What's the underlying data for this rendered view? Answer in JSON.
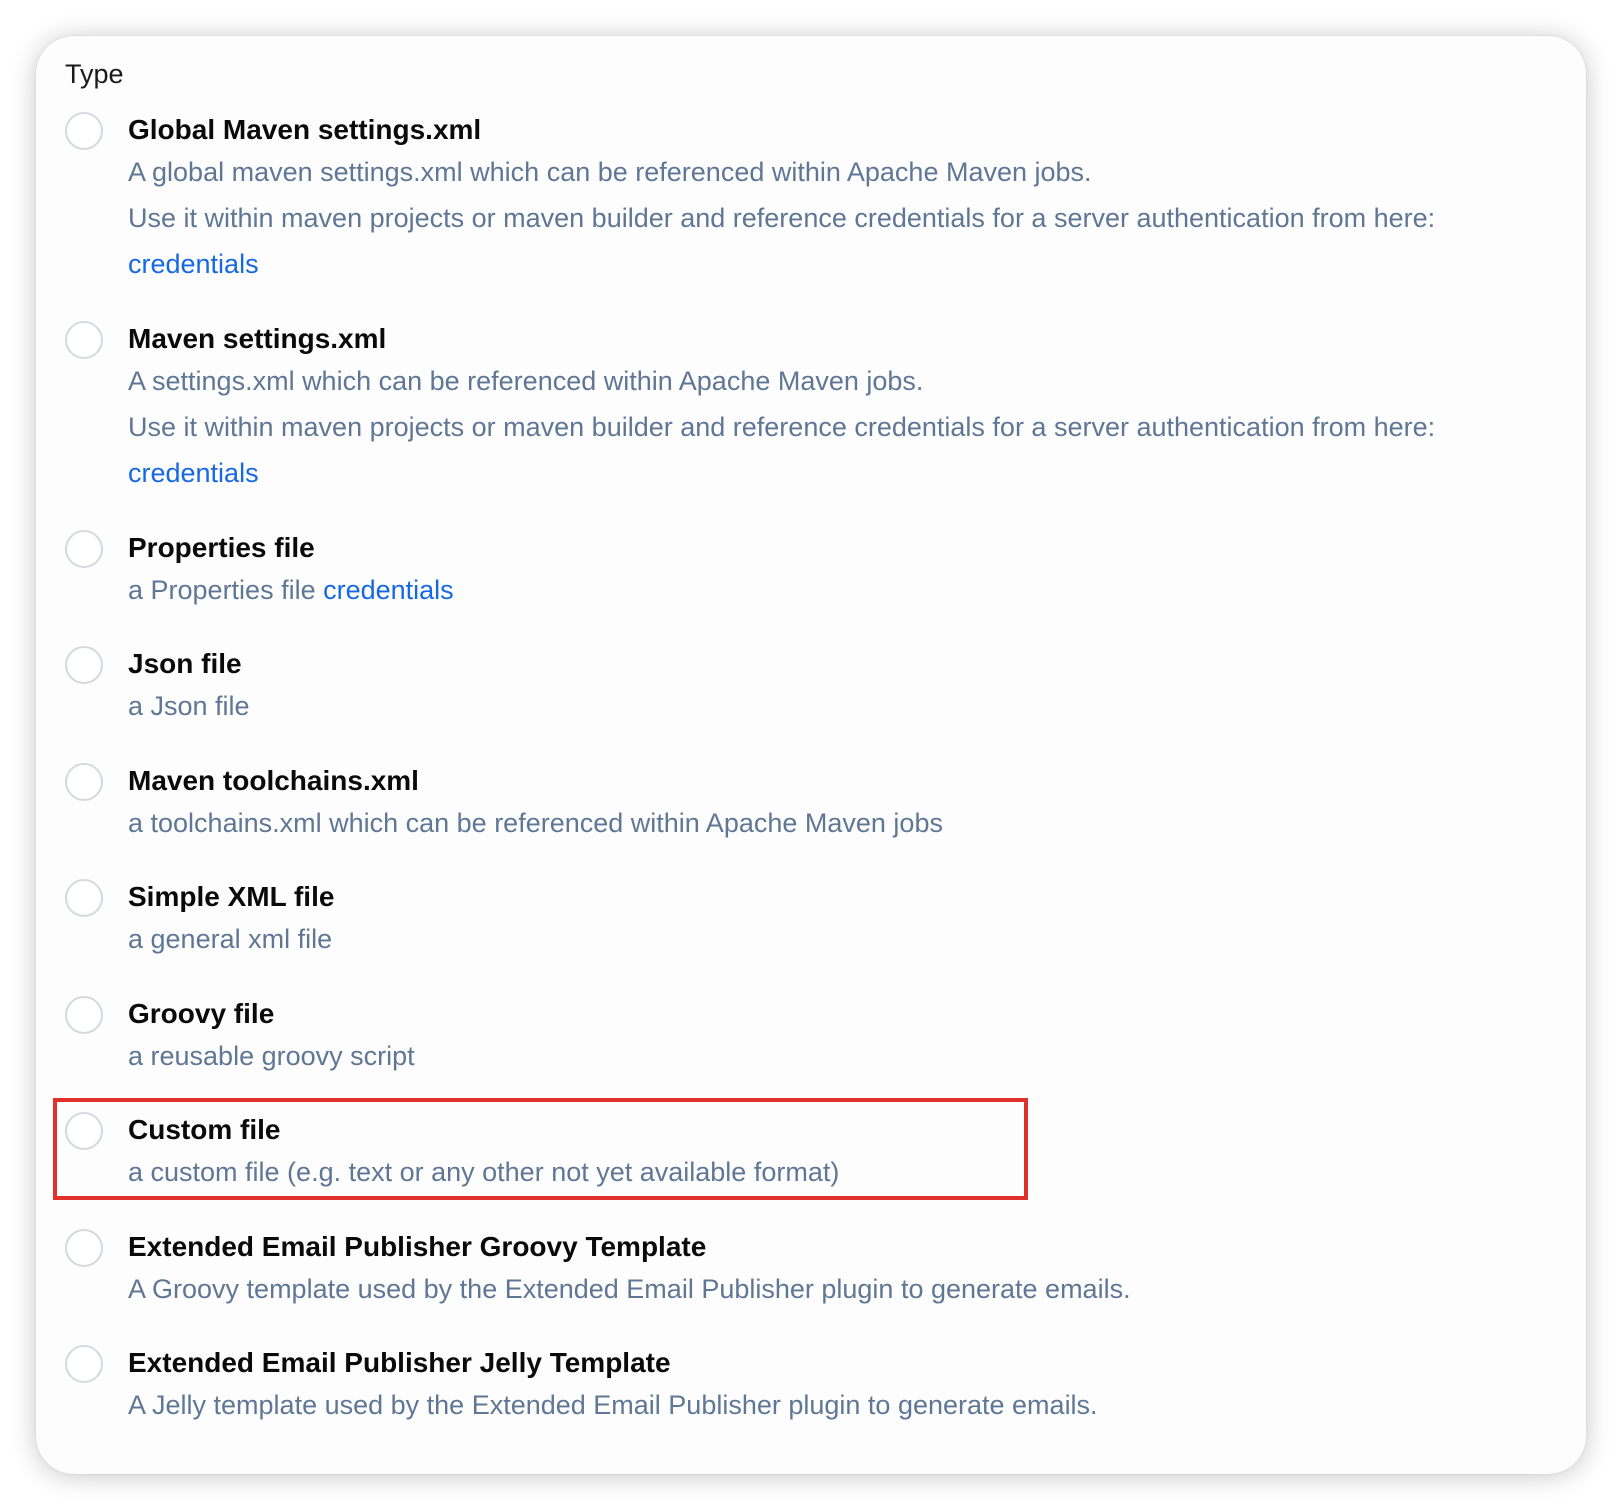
{
  "section_label": "Type",
  "options": [
    {
      "title": "Global Maven settings.xml",
      "desc1": "A global maven settings.xml which can be referenced within Apache Maven jobs.",
      "desc2": "Use it within maven projects or maven builder and reference credentials for a server authentication from here:",
      "link": "credentials"
    },
    {
      "title": "Maven settings.xml",
      "desc1": "A settings.xml which can be referenced within Apache Maven jobs.",
      "desc2": "Use it within maven projects or maven builder and reference credentials for a server authentication from here:",
      "link": "credentials"
    },
    {
      "title": "Properties file",
      "desc1": "a Properties file",
      "link": "credentials"
    },
    {
      "title": "Json file",
      "desc1": "a Json file"
    },
    {
      "title": "Maven toolchains.xml",
      "desc1": "a toolchains.xml which can be referenced within Apache Maven jobs"
    },
    {
      "title": "Simple XML file",
      "desc1": "a general xml file"
    },
    {
      "title": "Groovy file",
      "desc1": "a reusable groovy script"
    },
    {
      "title": "Custom file",
      "desc1": "a custom file (e.g. text or any other not yet available format)"
    },
    {
      "title": "Extended Email Publisher Groovy Template",
      "desc1": "A Groovy template used by the Extended Email Publisher plugin to generate emails."
    },
    {
      "title": "Extended Email Publisher Jelly Template",
      "desc1": "A Jelly template used by the Extended Email Publisher plugin to generate emails."
    }
  ],
  "colors": {
    "description": "#5f7795",
    "link": "#1668e3",
    "highlight_border": "#e0322b",
    "radio_border": "#d4d9e0"
  }
}
